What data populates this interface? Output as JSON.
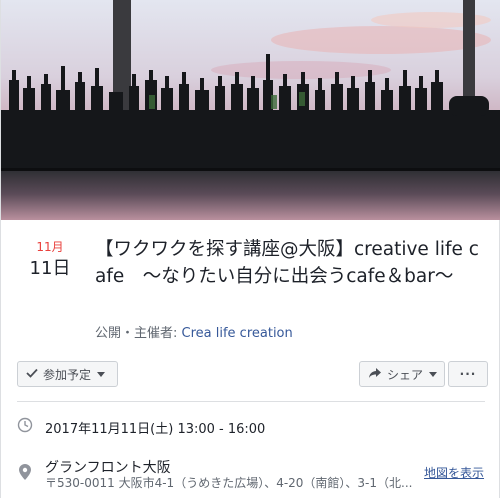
{
  "event": {
    "month": "11月",
    "day": "11日",
    "title": "【ワクワクを探す講座@大阪】creative life cafe　～なりたい自分に出会うcafe＆bar～",
    "host_prefix": "公開・主催者: ",
    "host_name": "Crea life creation"
  },
  "actions": {
    "going_label": "参加予定",
    "share_label": "シェア",
    "more_label": "···"
  },
  "details": {
    "datetime": "2017年11月11日(土) 13:00 - 16:00",
    "place_name": "グランフロント大阪",
    "place_address": "〒530-0011 大阪市4-1（うめきた広場）、4-20（南館）、3-1（北...",
    "map_link": "地図を表示"
  },
  "colors": {
    "month": "#e9413d",
    "link": "#365899",
    "muted": "#606770"
  },
  "icons": {
    "going": "check-icon",
    "share": "share-arrow-icon",
    "time": "clock-icon",
    "place": "location-pin-icon"
  }
}
